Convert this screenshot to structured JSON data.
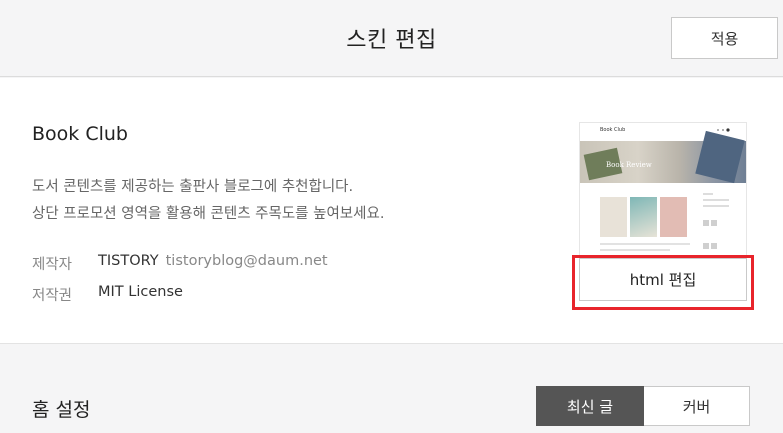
{
  "header": {
    "title": "스킨 편집",
    "apply_label": "적용"
  },
  "skin": {
    "name": "Book Club",
    "description": [
      "도서 콘텐츠를 제공하는 출판사 블로그에 추천합니다.",
      "상단 프로모션 영역을 활용해 콘텐츠 주목도를 높여보세요."
    ],
    "author_label": "제작자",
    "author": "TISTORY",
    "author_email": "tistoryblog@daum.net",
    "license_label": "저작권",
    "license": "MIT License",
    "thumbnail": {
      "logo": "Book Club",
      "hero_text": "Book Review"
    },
    "html_edit_label": "html 편집"
  },
  "home": {
    "title": "홈 설정",
    "options": [
      "최신 글",
      "커버"
    ],
    "selected": "최신 글"
  },
  "colors": {
    "highlight": "#e8242b",
    "active_segment": "#555555"
  }
}
